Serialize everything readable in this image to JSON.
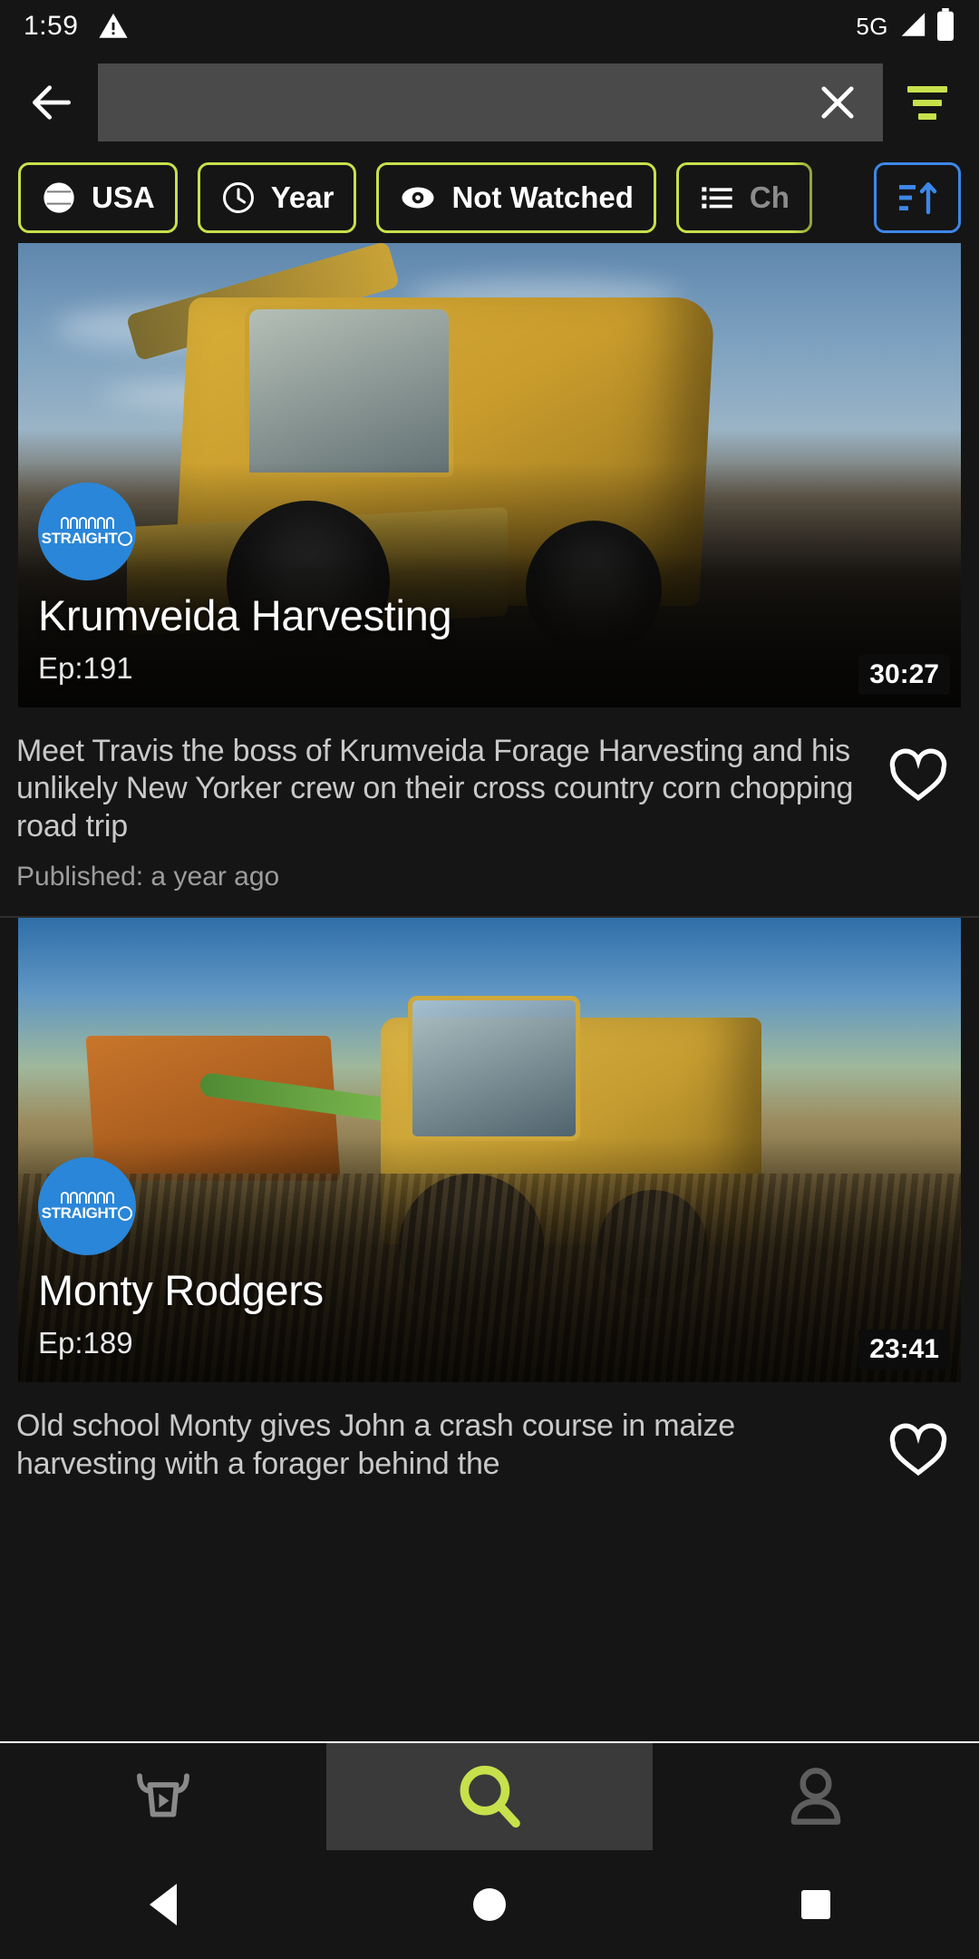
{
  "status_bar": {
    "time": "1:59",
    "warning_icon": "warning-triangle-icon",
    "network": "5G",
    "signal_icon": "signal-bars-icon",
    "battery_icon": "battery-icon"
  },
  "header": {
    "back_icon": "back-arrow-icon",
    "search_value": "",
    "search_placeholder": "",
    "clear_icon": "close-x-icon",
    "filter_icon": "filter-lines-icon"
  },
  "filters": {
    "chips": [
      {
        "label": "USA",
        "icon": "globe-icon",
        "color": "#c6e14b"
      },
      {
        "label": "Year",
        "icon": "clock-icon",
        "color": "#c6e14b"
      },
      {
        "label": "Not Watched",
        "icon": "eye-icon",
        "color": "#c6e14b"
      },
      {
        "label": "Ch",
        "icon": "list-icon",
        "color": "#c6e14b",
        "truncated": true
      }
    ],
    "sort_button": {
      "icon": "sort-icon",
      "color": "#3d87e8"
    }
  },
  "feed": {
    "items": [
      {
        "title": "Krumveida Harvesting",
        "episode": "Ep:191",
        "duration": "30:27",
        "channel_logo_text": "STRAIGHT",
        "channel_logo_suffix": "6",
        "description": "Meet Travis the boss of Krumveida Forage Harvesting and his unlikely New Yorker crew on their cross country corn chopping road trip",
        "published": "Published: a year ago",
        "favorite_icon": "heart-outline-icon"
      },
      {
        "title": "Monty Rodgers",
        "episode": "Ep:189",
        "duration": "23:41",
        "channel_logo_text": "STRAIGHT",
        "channel_logo_suffix": "6",
        "description": "Old school Monty gives John a crash course in maize harvesting with a forager behind the",
        "published": "",
        "favorite_icon": "heart-outline-icon"
      }
    ]
  },
  "bottom_nav": {
    "items": [
      {
        "name": "videos",
        "icon": "bull-play-icon",
        "active": false
      },
      {
        "name": "search",
        "icon": "search-icon",
        "active": true
      },
      {
        "name": "profile",
        "icon": "person-icon",
        "active": false
      }
    ],
    "active_color": "#c6e14b",
    "inactive_color": "#8a8a8a"
  },
  "android_nav": {
    "back": "back-triangle-icon",
    "home": "home-circle-icon",
    "recents": "recents-square-icon"
  }
}
